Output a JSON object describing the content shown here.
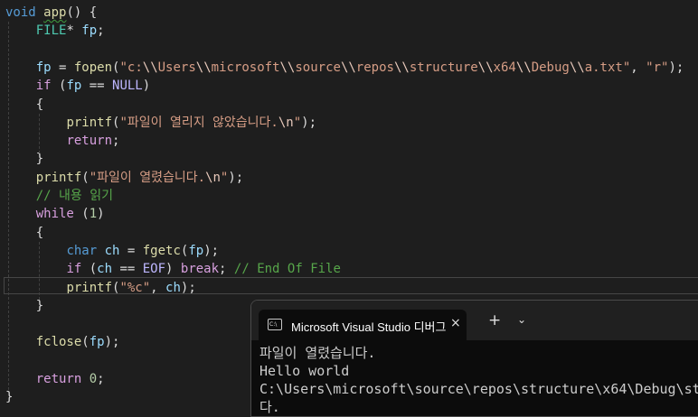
{
  "editor": {
    "lines": [
      [
        {
          "t": "void",
          "c": "kw"
        },
        {
          "t": " "
        },
        {
          "t": "app",
          "c": "fn squiggle"
        },
        {
          "t": "() {"
        }
      ],
      [
        {
          "t": "    "
        },
        {
          "t": "FILE",
          "c": "type"
        },
        {
          "t": "* "
        },
        {
          "t": "fp",
          "c": "var"
        },
        {
          "t": ";"
        }
      ],
      [],
      [
        {
          "t": "    "
        },
        {
          "t": "fp",
          "c": "var"
        },
        {
          "t": " = "
        },
        {
          "t": "fopen",
          "c": "fn"
        },
        {
          "t": "("
        },
        {
          "t": "\"c:",
          "c": "str"
        },
        {
          "t": "\\\\",
          "c": "esc"
        },
        {
          "t": "Users",
          "c": "str"
        },
        {
          "t": "\\\\",
          "c": "esc"
        },
        {
          "t": "microsoft",
          "c": "str"
        },
        {
          "t": "\\\\",
          "c": "esc"
        },
        {
          "t": "source",
          "c": "str"
        },
        {
          "t": "\\\\",
          "c": "esc"
        },
        {
          "t": "repos",
          "c": "str"
        },
        {
          "t": "\\\\",
          "c": "esc"
        },
        {
          "t": "structure",
          "c": "str"
        },
        {
          "t": "\\\\",
          "c": "esc"
        },
        {
          "t": "x64",
          "c": "str"
        },
        {
          "t": "\\\\",
          "c": "esc"
        },
        {
          "t": "Debug",
          "c": "str"
        },
        {
          "t": "\\\\",
          "c": "esc"
        },
        {
          "t": "a.txt\"",
          "c": "str"
        },
        {
          "t": ", "
        },
        {
          "t": "\"r\"",
          "c": "str"
        },
        {
          "t": ");"
        }
      ],
      [
        {
          "t": "    "
        },
        {
          "t": "if",
          "c": "ctl"
        },
        {
          "t": " ("
        },
        {
          "t": "fp",
          "c": "var"
        },
        {
          "t": " == "
        },
        {
          "t": "NULL",
          "c": "macro"
        },
        {
          "t": ")"
        }
      ],
      [
        {
          "t": "    {"
        }
      ],
      [
        {
          "t": "        "
        },
        {
          "t": "printf",
          "c": "fn"
        },
        {
          "t": "("
        },
        {
          "t": "\"파일이 열리지 않았습니다.",
          "c": "str"
        },
        {
          "t": "\\n",
          "c": "esc"
        },
        {
          "t": "\"",
          "c": "str"
        },
        {
          "t": ");"
        }
      ],
      [
        {
          "t": "        "
        },
        {
          "t": "return",
          "c": "ctl"
        },
        {
          "t": ";"
        }
      ],
      [
        {
          "t": "    }"
        }
      ],
      [
        {
          "t": "    "
        },
        {
          "t": "printf",
          "c": "fn"
        },
        {
          "t": "("
        },
        {
          "t": "\"파일이 열렸습니다.",
          "c": "str"
        },
        {
          "t": "\\n",
          "c": "esc"
        },
        {
          "t": "\"",
          "c": "str"
        },
        {
          "t": ");"
        }
      ],
      [
        {
          "t": "    "
        },
        {
          "t": "// 내용 읽기",
          "c": "cmt"
        }
      ],
      [
        {
          "t": "    "
        },
        {
          "t": "while",
          "c": "ctl"
        },
        {
          "t": " ("
        },
        {
          "t": "1",
          "c": "num"
        },
        {
          "t": ")"
        }
      ],
      [
        {
          "t": "    {"
        }
      ],
      [
        {
          "t": "        "
        },
        {
          "t": "char",
          "c": "kw"
        },
        {
          "t": " "
        },
        {
          "t": "ch",
          "c": "var"
        },
        {
          "t": " = "
        },
        {
          "t": "fgetc",
          "c": "fn"
        },
        {
          "t": "("
        },
        {
          "t": "fp",
          "c": "var"
        },
        {
          "t": ");"
        }
      ],
      [
        {
          "t": "        "
        },
        {
          "t": "if",
          "c": "ctl"
        },
        {
          "t": " ("
        },
        {
          "t": "ch",
          "c": "var"
        },
        {
          "t": " == "
        },
        {
          "t": "EOF",
          "c": "macro"
        },
        {
          "t": ") "
        },
        {
          "t": "break",
          "c": "ctl"
        },
        {
          "t": "; "
        },
        {
          "t": "// End Of File",
          "c": "cmt"
        }
      ],
      [
        {
          "t": "        "
        },
        {
          "t": "printf",
          "c": "fn"
        },
        {
          "t": "("
        },
        {
          "t": "\"%c\"",
          "c": "str"
        },
        {
          "t": ", "
        },
        {
          "t": "ch",
          "c": "var"
        },
        {
          "t": ");"
        }
      ],
      [
        {
          "t": "    }"
        }
      ],
      [],
      [
        {
          "t": "    "
        },
        {
          "t": "fclose",
          "c": "fn"
        },
        {
          "t": "("
        },
        {
          "t": "fp",
          "c": "var"
        },
        {
          "t": ");"
        }
      ],
      [],
      [
        {
          "t": "    "
        },
        {
          "t": "return",
          "c": "ctl"
        },
        {
          "t": " "
        },
        {
          "t": "0",
          "c": "num"
        },
        {
          "t": ";"
        }
      ],
      [
        {
          "t": "}"
        }
      ]
    ]
  },
  "terminal": {
    "tab_icon_text": "C:\\",
    "tab_title": "Microsoft Visual Studio 디버그",
    "close_icon": "×",
    "new_tab_icon": "+",
    "dropdown_icon": "⌄",
    "output": [
      "파일이 열렸습니다.",
      "Hello world",
      "C:\\Users\\microsoft\\source\\repos\\structure\\x64\\Debug\\st",
      "다."
    ]
  }
}
